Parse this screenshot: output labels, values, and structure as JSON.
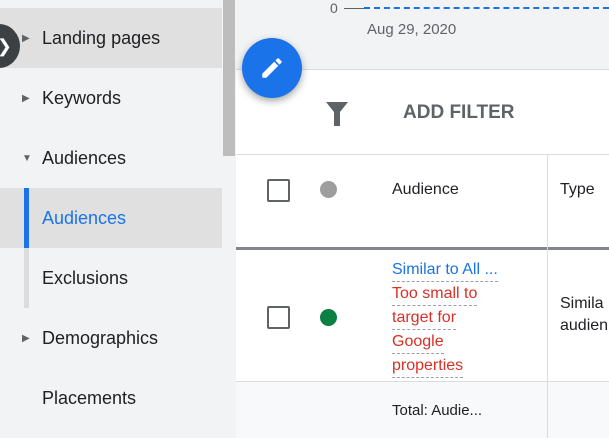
{
  "sidebar": {
    "items": [
      {
        "label": "Landing pages"
      },
      {
        "label": "Keywords"
      },
      {
        "label": "Audiences"
      },
      {
        "label": "Audiences"
      },
      {
        "label": "Exclusions"
      },
      {
        "label": "Demographics"
      },
      {
        "label": "Placements"
      }
    ]
  },
  "chart": {
    "y_tick": "0",
    "x_tick": "Aug 29, 2020"
  },
  "toolbar": {
    "add_filter": "ADD FILTER"
  },
  "table": {
    "headers": {
      "audience": "Audience",
      "type": "Type"
    },
    "rows": [
      {
        "audience": "Similar to All ...",
        "warning": [
          "Too small to",
          "target for",
          "Google",
          "properties"
        ],
        "type": [
          "Simila",
          "audien"
        ]
      }
    ],
    "total": "Total: Audie..."
  },
  "colors": {
    "accent": "#1a73e8",
    "warning": "#d93025",
    "enabled": "#0b8043"
  }
}
